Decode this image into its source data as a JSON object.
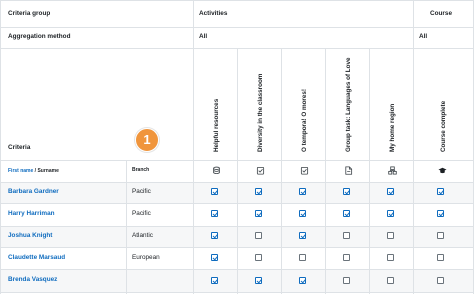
{
  "header": {
    "criteria_group_label": "Criteria group",
    "activities_label": "Activities",
    "course_label": "Course",
    "aggregation_label": "Aggregation method",
    "aggregation_activities": "All",
    "aggregation_course": "All",
    "criteria_label": "Criteria"
  },
  "columns": [
    {
      "label": "Helpful resources",
      "icon": "resource-icon"
    },
    {
      "label": "Diversity in the classroom",
      "icon": "assignment-icon"
    },
    {
      "label": "O tempora! O mores!",
      "icon": "assignment-icon"
    },
    {
      "label": "Group task: Languages of Love",
      "icon": "file-icon"
    },
    {
      "label": "My home region",
      "icon": "group-icon"
    },
    {
      "label": "Course complete",
      "icon": "graduation-cap-icon"
    }
  ],
  "subheader": {
    "first_name": "First name",
    "separator": " / ",
    "surname": "Surname",
    "branch": "Branch"
  },
  "badge": {
    "number": "1",
    "color": "#f0953c"
  },
  "rows": [
    {
      "name": "Barbara Gardner",
      "branch": "Pacific",
      "status": [
        true,
        true,
        true,
        true,
        true,
        true
      ]
    },
    {
      "name": "Harry Harriman",
      "branch": "Pacific",
      "status": [
        true,
        true,
        true,
        true,
        true,
        true
      ]
    },
    {
      "name": "Joshua Knight",
      "branch": "Atlantic",
      "status": [
        true,
        false,
        true,
        false,
        false,
        false
      ]
    },
    {
      "name": "Claudette Marsaud",
      "branch": "European",
      "status": [
        true,
        false,
        false,
        false,
        false,
        false
      ]
    },
    {
      "name": "Brenda Vasquez",
      "branch": "",
      "status": [
        true,
        true,
        true,
        false,
        false,
        false
      ]
    }
  ],
  "colors": {
    "link": "#0f6cbf",
    "border": "#dee2e6",
    "band": "#f6f7f8",
    "check": "#0f6cbf"
  }
}
